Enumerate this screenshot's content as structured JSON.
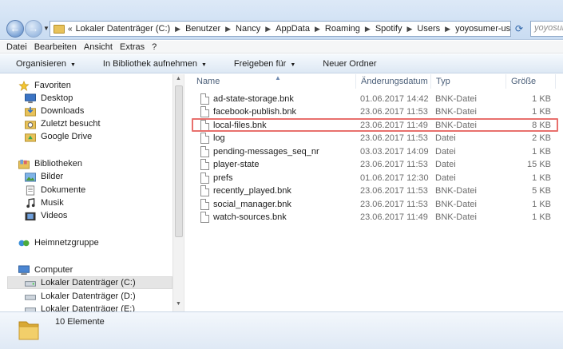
{
  "nav": {
    "back_icon": "arrow-left-icon",
    "forward_icon": "arrow-right-icon"
  },
  "address": {
    "crumbs": [
      "Lokaler Datenträger (C:)",
      "Benutzer",
      "Nancy",
      "AppData",
      "Roaming",
      "Spotify",
      "Users",
      "yoyosumer-user"
    ]
  },
  "search": {
    "value": "yoyosum"
  },
  "menubar": {
    "items": [
      "Datei",
      "Bearbeiten",
      "Ansicht",
      "Extras",
      "?"
    ]
  },
  "commandbar": {
    "items": [
      "Organisieren",
      "In Bibliothek aufnehmen",
      "Freigeben für",
      "Neuer Ordner"
    ]
  },
  "navpane": {
    "favorites_header": "Favoriten",
    "favorites": [
      "Desktop",
      "Downloads",
      "Zuletzt besucht",
      "Google Drive"
    ],
    "libraries_header": "Bibliotheken",
    "libraries": [
      "Bilder",
      "Dokumente",
      "Musik",
      "Videos"
    ],
    "homegroup": "Heimnetzgruppe",
    "computer_header": "Computer",
    "drives": [
      "Lokaler Datenträger (C:)",
      "Lokaler Datenträger (D:)",
      "Lokaler Datenträger (E:)"
    ]
  },
  "columns": {
    "name": "Name",
    "date": "Änderungsdatum",
    "type": "Typ",
    "size": "Größe"
  },
  "files": [
    {
      "name": "ad-state-storage.bnk",
      "date": "01.06.2017 14:42",
      "type": "BNK-Datei",
      "size": "1 KB"
    },
    {
      "name": "facebook-publish.bnk",
      "date": "23.06.2017 11:53",
      "type": "BNK-Datei",
      "size": "1 KB"
    },
    {
      "name": "local-files.bnk",
      "date": "23.06.2017 11:49",
      "type": "BNK-Datei",
      "size": "8 KB"
    },
    {
      "name": "log",
      "date": "23.06.2017 11:53",
      "type": "Datei",
      "size": "2 KB"
    },
    {
      "name": "pending-messages_seq_nr",
      "date": "03.03.2017 14:09",
      "type": "Datei",
      "size": "1 KB"
    },
    {
      "name": "player-state",
      "date": "23.06.2017 11:53",
      "type": "Datei",
      "size": "15 KB"
    },
    {
      "name": "prefs",
      "date": "01.06.2017 12:30",
      "type": "Datei",
      "size": "1 KB"
    },
    {
      "name": "recently_played.bnk",
      "date": "23.06.2017 11:53",
      "type": "BNK-Datei",
      "size": "5 KB"
    },
    {
      "name": "social_manager.bnk",
      "date": "23.06.2017 11:53",
      "type": "BNK-Datei",
      "size": "1 KB"
    },
    {
      "name": "watch-sources.bnk",
      "date": "23.06.2017 11:49",
      "type": "BNK-Datei",
      "size": "1 KB"
    }
  ],
  "highlight_color": "#e8706d",
  "status": {
    "count": "10 Elemente"
  }
}
